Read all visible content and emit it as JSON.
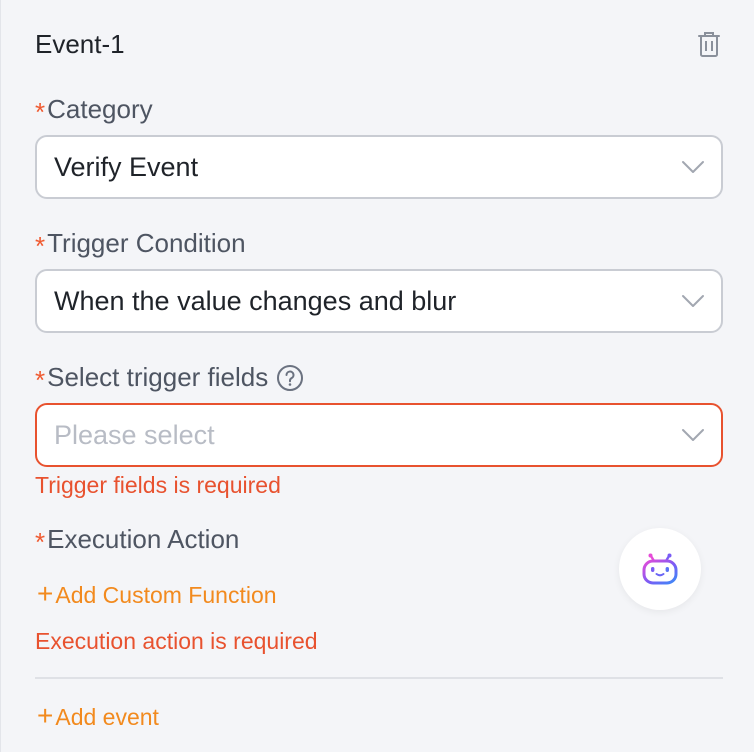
{
  "event": {
    "title": "Event-1",
    "delete_icon": "trash-icon"
  },
  "category": {
    "required_mark": "*",
    "label": "Category",
    "value": "Verify Event"
  },
  "trigger_condition": {
    "required_mark": "*",
    "label": "Trigger Condition",
    "value": "When the value changes and blur"
  },
  "trigger_fields": {
    "required_mark": "*",
    "label": "Select trigger fields",
    "help_icon": "question-circle-icon",
    "placeholder": "Please select",
    "error": "Trigger fields is required"
  },
  "execution_action": {
    "required_mark": "*",
    "label": "Execution Action",
    "add_plus": "+",
    "add_label": "Add Custom Function",
    "error": "Execution action is required"
  },
  "footer": {
    "add_plus": "+",
    "add_event_label": "Add event"
  },
  "assistant": {
    "icon": "robot-assistant-icon"
  },
  "colors": {
    "required": "#f05a30",
    "error": "#e8522f",
    "link": "#f28a1e",
    "border": "#c9ccd3",
    "background": "#f4f5f8"
  }
}
